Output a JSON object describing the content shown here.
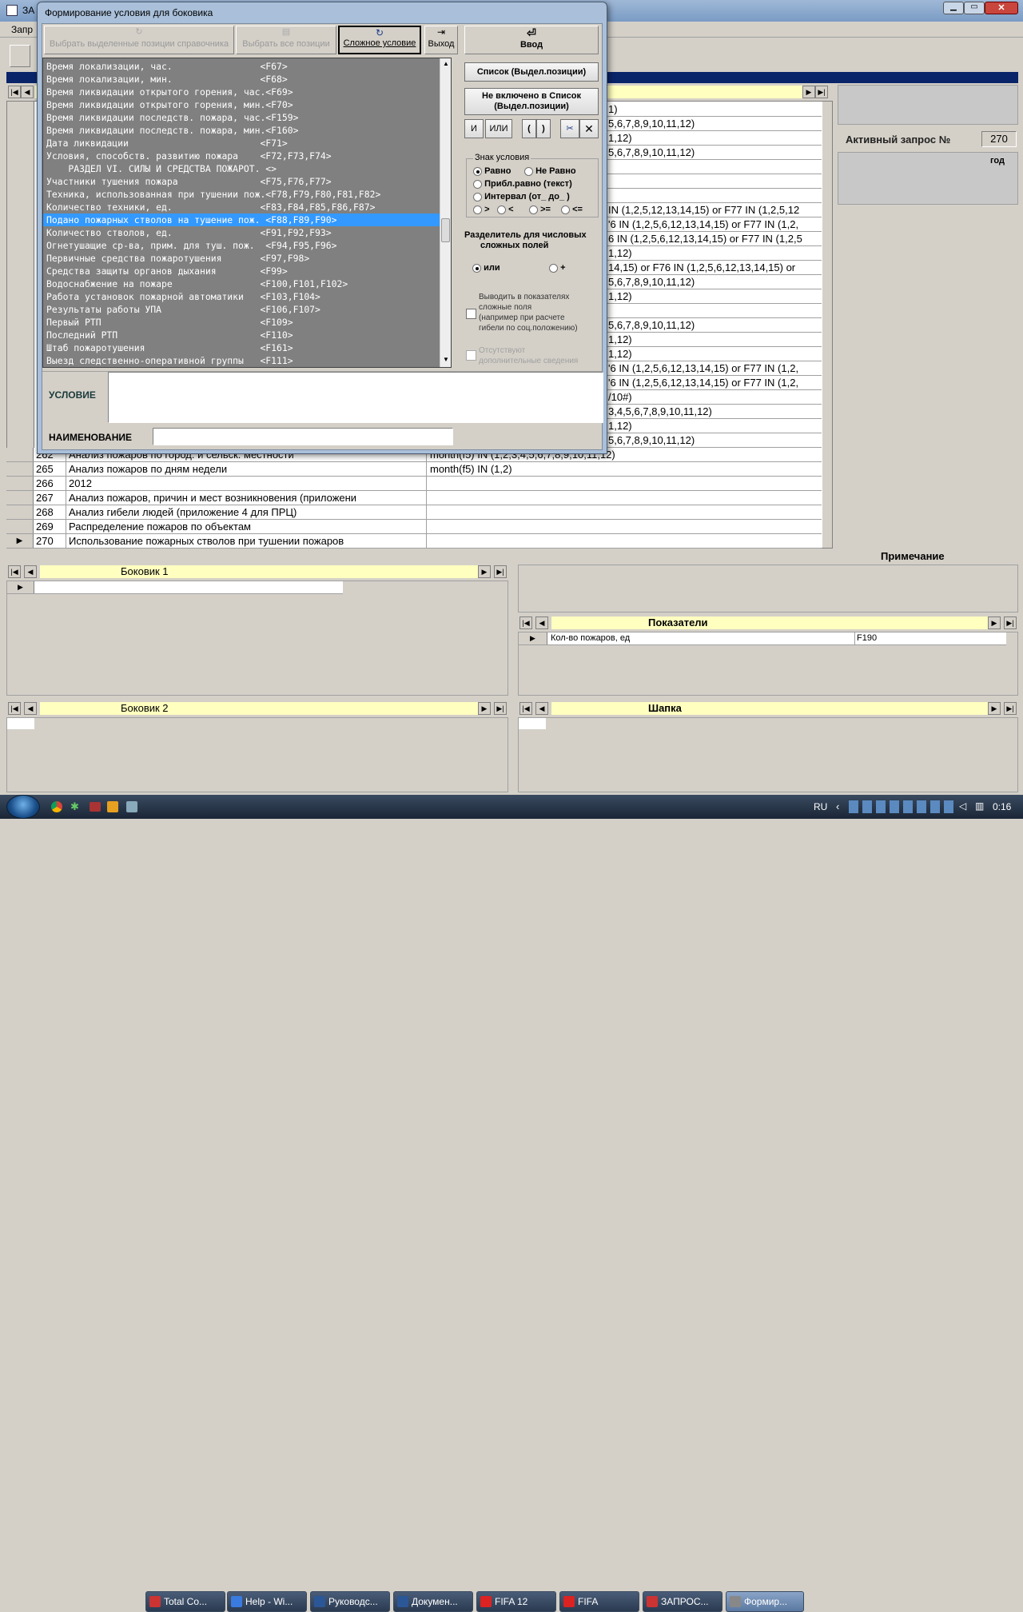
{
  "main_window": {
    "title_fragment": "ЗА",
    "menu_fragment": "Запр"
  },
  "grid": {
    "rows": [
      {
        "num": "262",
        "name": "Анализ пожаров по город. и сельск. местности",
        "cond": "month(f5) IN (1,2,3,4,5,6,7,8,9,10,11,12)"
      },
      {
        "num": "265",
        "name": "Анализ пожаров по дням недели",
        "cond": "month(f5) IN (1,2)"
      },
      {
        "num": "266",
        "name": "2012",
        "cond": ""
      },
      {
        "num": "267",
        "name": "Анализ пожаров, причин и мест возникновения (приложени",
        "cond": ""
      },
      {
        "num": "268",
        "name": "Анализ гибели людей (приложение 4 для ПРЦ)",
        "cond": ""
      },
      {
        "num": "269",
        "name": "Распределение пожаров по объектам",
        "cond": ""
      },
      {
        "num": "270",
        "name": "Использование пожарных стволов при тушении пожаров",
        "cond": ""
      }
    ],
    "right_cells": [
      "1)",
      "5,6,7,8,9,10,11,12)",
      "1,12)",
      "5,6,7,8,9,10,11,12)",
      "",
      "",
      "",
      "IN (1,2,5,12,13,14,15) or F77 IN (1,2,5,12",
      "'6 IN (1,2,5,6,12,13,14,15) or F77 IN (1,2,",
      "6 IN (1,2,5,6,12,13,14,15) or F77 IN (1,2,5",
      "1,12)",
      "14,15) or F76 IN (1,2,5,6,12,13,14,15) or",
      "5,6,7,8,9,10,11,12)",
      "1,12)",
      "",
      "5,6,7,8,9,10,11,12)",
      "1,12)",
      "1,12)",
      "'6 IN (1,2,5,6,12,13,14,15) or F77 IN (1,2,",
      "'6 IN (1,2,5,6,12,13,14,15) or F77 IN (1,2,",
      "/10#)",
      "3,4,5,6,7,8,9,10,11,12)",
      "1,12)",
      "5,6,7,8,9,10,11,12)"
    ],
    "current_marker": "▶"
  },
  "right_panel": {
    "active_query_label": "Активный запрос №",
    "active_query_value": "270",
    "year_label": "год",
    "note_label": "Примечание"
  },
  "bokovik1": {
    "title": "Боковик 1"
  },
  "bokovik2": {
    "title": "Боковик 2"
  },
  "pokazateli": {
    "title": "Показатели",
    "row_name": "Кол-во пожаров, ед",
    "row_code": "F190"
  },
  "shapka": {
    "title": "Шапка"
  },
  "dialog": {
    "title": "Формирование условия для боковика",
    "toolbar": {
      "select_selected": "Выбрать выделенные позиции справочника",
      "select_all": "Выбрать все позиции",
      "complex": "Сложное условие",
      "exit": "Выход",
      "enter": "Ввод"
    },
    "list_items": [
      "Время локализации, час.                <F67>",
      "Время локализации, мин.                <F68>",
      "Время ликвидации открытого горения, час.<F69>",
      "Время ликвидации открытого горения, мин.<F70>",
      "Время ликвидации последств. пожара, час.<F159>",
      "Время ликвидации последств. пожара, мин.<F160>",
      "Дата ликвидации                        <F71>",
      "Условия, способств. развитию пожара    <F72,F73,F74>",
      "    РАЗДЕЛ VI. СИЛЫ И СРЕДСТВА ПОЖАРОТ. <>",
      "Участники тушения пожара               <F75,F76,F77>",
      "Техника, использованная при тушении пож.<F78,F79,F80,F81,F82>",
      "Количество техники, ед.                <F83,F84,F85,F86,F87>",
      "Подано пожарных стволов на тушение пож. <F88,F89,F90>",
      "Количество стволов, ед.                <F91,F92,F93>",
      "Огнетушащие ср-ва, прим. для туш. пож.  <F94,F95,F96>",
      "Первичные средства пожаротушения       <F97,F98>",
      "Средства защиты органов дыхания        <F99>",
      "Водоснабжение на пожаре                <F100,F101,F102>",
      "Работа установок пожарной автоматики   <F103,F104>",
      "Результаты работы УПА                  <F106,F107>",
      "Первый РТП                             <F109>",
      "Последний РТП                          <F110>",
      "Штаб пожаротушения                     <F161>",
      "Выезд следственно-оперативной группы   <F111>"
    ],
    "selected_index": 12,
    "side": {
      "list_btn": "Список  (Выдел.позиции)",
      "not_in_list_1": "Не включено в Список",
      "not_in_list_2": "(Выдел.позиции)",
      "and": "И",
      "or": "ИЛИ",
      "lparen": "(",
      "rparen": ")",
      "sign_group": "Знак условия",
      "eq": "Равно",
      "neq": "Не Равно",
      "approx": "Прибл.равно (текст)",
      "interval": "Интервал (от_ до_ )",
      "gt": ">",
      "lt": "<",
      "ge": ">=",
      "le": "<=",
      "separator_1": "Разделитель для числовых",
      "separator_2": "сложных полей",
      "sep_or": "или",
      "sep_plus": "+",
      "output_1": "Выводить в показателях",
      "output_2": "сложные поля",
      "output_3": "(например при расчете",
      "output_4": "гибели по соц.положению)",
      "extra_1": "Отсутствуют",
      "extra_2": "дополнительные сведения"
    },
    "condition_label": "УСЛОВИЕ",
    "condition_value": "",
    "name_label": "НАИМЕНОВАНИЕ",
    "name_value": ""
  },
  "taskbar": {
    "items": [
      "Total Co...",
      "Help - Wi...",
      "Руководс...",
      "Докумен...",
      "FIFA 12",
      "FIFA",
      "ЗАПРОС...",
      "Формир..."
    ],
    "lang": "RU",
    "clock": "0:16"
  },
  "colors": {
    "dialog_list_bg": "#808080",
    "selection": "#3399ff",
    "yellow": "#ffffc0",
    "header_blue": "#0a246a"
  }
}
